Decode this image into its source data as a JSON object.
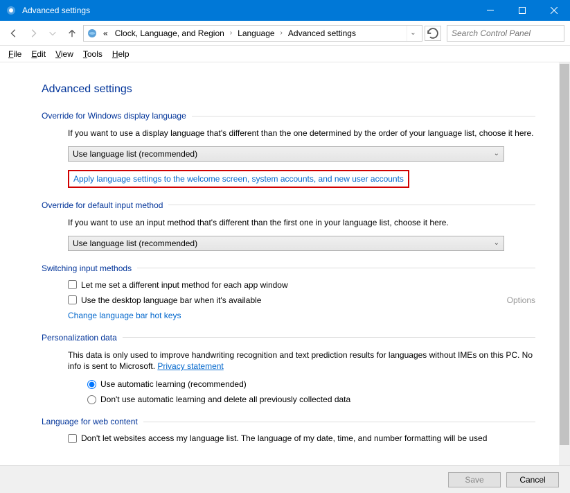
{
  "window": {
    "title": "Advanced settings"
  },
  "breadcrumb": {
    "prefix": "«",
    "items": [
      "Clock, Language, and Region",
      "Language",
      "Advanced settings"
    ]
  },
  "search": {
    "placeholder": "Search Control Panel"
  },
  "menu": {
    "file": "File",
    "edit": "Edit",
    "view": "View",
    "tools": "Tools",
    "help": "Help"
  },
  "page": {
    "title": "Advanced settings"
  },
  "sections": {
    "display_lang": {
      "header": "Override for Windows display language",
      "desc": "If you want to use a display language that's different than the one determined by the order of your language list, choose it here.",
      "dropdown": "Use language list (recommended)",
      "apply_link": "Apply language settings to the welcome screen, system accounts, and new user accounts"
    },
    "input_method": {
      "header": "Override for default input method",
      "desc": "If you want to use an input method that's different than the first one in your language list, choose it here.",
      "dropdown": "Use language list (recommended)"
    },
    "switching": {
      "header": "Switching input methods",
      "check1": "Let me set a different input method for each app window",
      "check2": "Use the desktop language bar when it's available",
      "options": "Options",
      "hotkeys_link": "Change language bar hot keys"
    },
    "personalization": {
      "header": "Personalization data",
      "desc_a": "This data is only used to improve handwriting recognition and text prediction results for languages without IMEs on this PC. No info is sent to Microsoft. ",
      "privacy_link": "Privacy statement",
      "radio1": "Use automatic learning (recommended)",
      "radio2": "Don't use automatic learning and delete all previously collected data"
    },
    "web": {
      "header": "Language for web content",
      "check1": "Don't let websites access my language list. The language of my date, time, and number formatting will be used"
    }
  },
  "buttons": {
    "save": "Save",
    "cancel": "Cancel"
  }
}
